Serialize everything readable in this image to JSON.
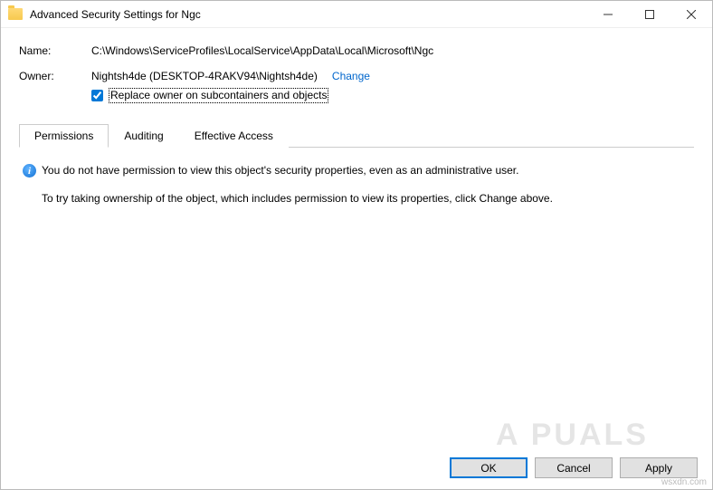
{
  "titlebar": {
    "title": "Advanced Security Settings for Ngc"
  },
  "info": {
    "name_label": "Name:",
    "name_value": "C:\\Windows\\ServiceProfiles\\LocalService\\AppData\\Local\\Microsoft\\Ngc",
    "owner_label": "Owner:",
    "owner_value": "Nightsh4de (DESKTOP-4RAKV94\\Nightsh4de)",
    "change_link": "Change",
    "replace_checkbox_label": "Replace owner on subcontainers and objects"
  },
  "tabs": {
    "items": [
      {
        "label": "Permissions",
        "active": true
      },
      {
        "label": "Auditing",
        "active": false
      },
      {
        "label": "Effective Access",
        "active": false
      }
    ]
  },
  "body": {
    "line1": "You do not have permission to view this object's security properties, even as an administrative user.",
    "line2": "To try taking ownership of the object, which includes permission to view its properties, click Change above."
  },
  "buttons": {
    "ok": "OK",
    "cancel": "Cancel",
    "apply": "Apply"
  },
  "watermark": "A  PUALS",
  "credit": "wsxdn.com"
}
